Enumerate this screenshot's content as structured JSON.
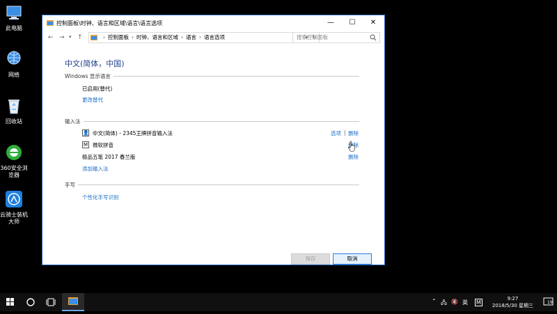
{
  "desktop": {
    "icons": [
      {
        "label": "此电脑"
      },
      {
        "label": "网络"
      },
      {
        "label": "回收站"
      },
      {
        "label": "360安全浏览器"
      },
      {
        "label": "云骑士装机大师"
      }
    ]
  },
  "window": {
    "title": "控制面板\\时钟、语言和区域\\语言\\语言选项",
    "controls": {
      "minimize": "—",
      "maximize": "☐",
      "close": "✕"
    },
    "address": {
      "crumbs": [
        "控制面板",
        "时钟、语言和区域",
        "语言",
        "语言选项"
      ],
      "separator": "›"
    },
    "search": {
      "placeholder": "搜索控制面板"
    },
    "content": {
      "language_title": "中文(简体，中国)",
      "display_section": {
        "header": "Windows 显示语言",
        "status": "已启用(替代)",
        "change_link": "更改替代"
      },
      "ime_section": {
        "header": "输入法",
        "items": [
          {
            "name": "中文(简体) - 2345王牌拼音输入法",
            "options": "选项",
            "divider": "|",
            "remove": "删除"
          },
          {
            "name": "微软拼音",
            "icon_text": "M",
            "remove": "删除"
          },
          {
            "name": "极品五笔 2017 春兰版",
            "remove": "删除"
          }
        ],
        "add_link": "添加输入法"
      },
      "handwriting_section": {
        "header": "手写",
        "link": "个性化手写识别"
      }
    },
    "buttons": {
      "save": "保存",
      "cancel": "取消"
    }
  },
  "taskbar": {
    "tray": {
      "language": "英",
      "ime": "M",
      "time": "9:27",
      "date": "2018/5/30 星期三",
      "notifications": "19"
    }
  },
  "colors": {
    "link": "#1c6ec6",
    "title_blue": "#1e3f8a",
    "taskbar": "#101010"
  }
}
